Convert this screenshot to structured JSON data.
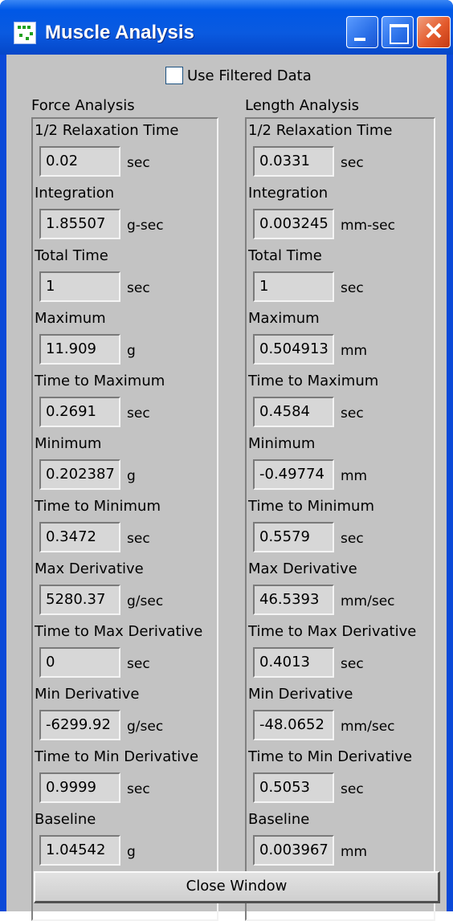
{
  "window": {
    "title": "Muscle Analysis"
  },
  "filter": {
    "label": "Use Filtered Data",
    "checked": false
  },
  "force": {
    "title": "Force Analysis",
    "items": [
      {
        "label": "1/2 Relaxation Time",
        "value": "0.02",
        "unit": "sec"
      },
      {
        "label": "Integration",
        "value": "1.85507",
        "unit": "g-sec"
      },
      {
        "label": "Total Time",
        "value": "1",
        "unit": "sec"
      },
      {
        "label": "Maximum",
        "value": "11.909",
        "unit": "g"
      },
      {
        "label": "Time to Maximum",
        "value": "0.2691",
        "unit": "sec"
      },
      {
        "label": "Minimum",
        "value": "0.202387",
        "unit": "g"
      },
      {
        "label": "Time to Minimum",
        "value": "0.3472",
        "unit": "sec"
      },
      {
        "label": "Max Derivative",
        "value": "5280.37",
        "unit": "g/sec"
      },
      {
        "label": "Time to Max Derivative",
        "value": "0",
        "unit": "sec"
      },
      {
        "label": "Min Derivative",
        "value": "-6299.92",
        "unit": "g/sec"
      },
      {
        "label": "Time to Min Derivative",
        "value": "0.9999",
        "unit": "sec"
      },
      {
        "label": "Baseline",
        "value": "1.04542",
        "unit": "g"
      }
    ]
  },
  "length": {
    "title": "Length Analysis",
    "items": [
      {
        "label": "1/2 Relaxation Time",
        "value": "0.0331",
        "unit": "sec"
      },
      {
        "label": "Integration",
        "value": "0.003245",
        "unit": "mm-sec"
      },
      {
        "label": "Total Time",
        "value": "1",
        "unit": "sec"
      },
      {
        "label": "Maximum",
        "value": "0.504913",
        "unit": "mm"
      },
      {
        "label": "Time to Maximum",
        "value": "0.4584",
        "unit": "sec"
      },
      {
        "label": "Minimum",
        "value": "-0.49774",
        "unit": "mm"
      },
      {
        "label": "Time to Minimum",
        "value": "0.5579",
        "unit": "sec"
      },
      {
        "label": "Max Derivative",
        "value": "46.5393",
        "unit": "mm/sec"
      },
      {
        "label": "Time to Max Derivative",
        "value": "0.4013",
        "unit": "sec"
      },
      {
        "label": "Min Derivative",
        "value": "-48.0652",
        "unit": "mm/sec"
      },
      {
        "label": "Time to Min Derivative",
        "value": "0.5053",
        "unit": "sec"
      },
      {
        "label": "Baseline",
        "value": "0.003967",
        "unit": "mm"
      }
    ]
  },
  "actions": {
    "close_label": "Close Window"
  },
  "icons": {
    "app": "app-icon",
    "minimize": "minimize-icon",
    "maximize": "maximize-icon",
    "close": "close-icon"
  },
  "colors": {
    "titlebar": "#0058e6",
    "close_button": "#e35a2c",
    "panel_background": "#c3c3c3",
    "field_background": "#d7d7d7"
  }
}
